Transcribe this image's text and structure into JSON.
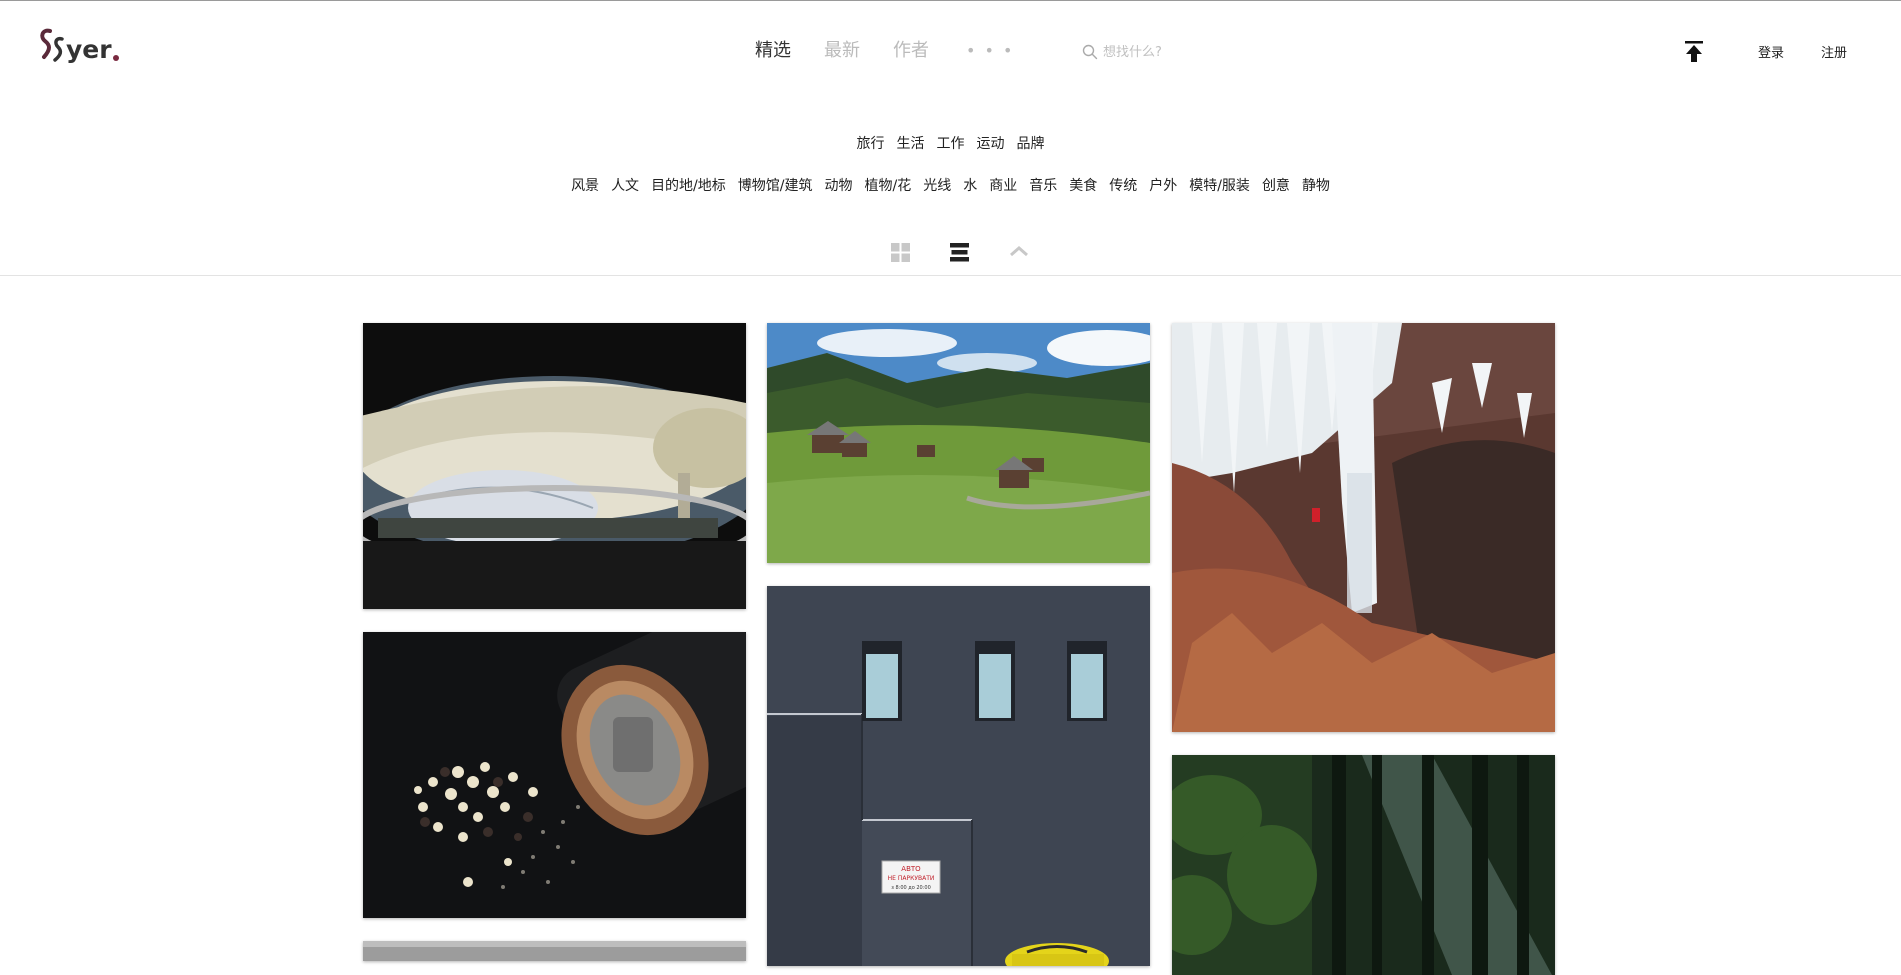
{
  "brand": {
    "logo_text": "yer"
  },
  "nav": {
    "items": [
      {
        "label": "精选",
        "active": true
      },
      {
        "label": "最新",
        "active": false
      },
      {
        "label": "作者",
        "active": false
      }
    ],
    "more_label": "• • •"
  },
  "search": {
    "placeholder": "想找什么?"
  },
  "account": {
    "login_label": "登录",
    "register_label": "注册"
  },
  "categories": {
    "primary": [
      "旅行",
      "生活",
      "工作",
      "运动",
      "品牌"
    ],
    "secondary": [
      "风景",
      "人文",
      "目的地/地标",
      "博物馆/建筑",
      "动物",
      "植物/花",
      "光线",
      "水",
      "商业",
      "音乐",
      "美食",
      "传统",
      "户外",
      "模特/服装",
      "创意",
      "静物"
    ]
  },
  "view_toggle": {
    "active": "list-view"
  },
  "colors": {
    "accent": "#7a2a40",
    "text": "#222222",
    "muted": "#bbbbbb"
  },
  "gallery": {
    "photos": [
      {
        "subject": "membrane roof architecture"
      },
      {
        "subject": "alpine village meadow"
      },
      {
        "subject": "frozen waterfall"
      },
      {
        "subject": "pepper grinder with peppercorns"
      },
      {
        "subject": "grey building with windows and yellow car"
      },
      {
        "subject": "sunlit forest"
      },
      {
        "subject": "grey photo"
      }
    ],
    "sign_text": [
      "АВТО",
      "НЕ ПАРКУВАТИ",
      "з 8:00 до 20:00"
    ]
  }
}
